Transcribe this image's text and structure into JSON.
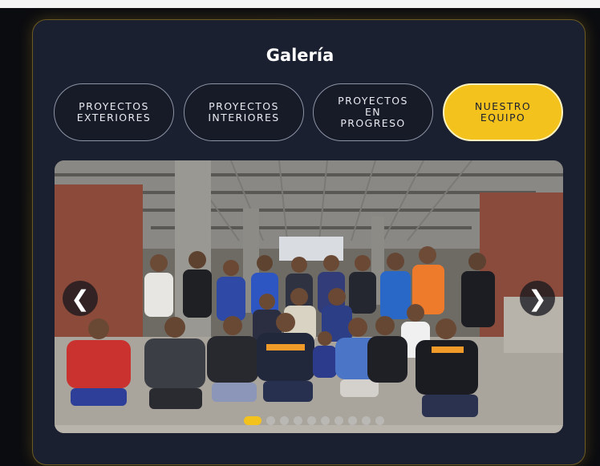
{
  "gallery_section": {
    "title": "Galería",
    "tabs": [
      {
        "label": "PROYECTOS\nEXTERIORES",
        "active": false
      },
      {
        "label": "PROYECTOS\nINTERIORES",
        "active": false
      },
      {
        "label": "PROYECTOS\nEN\nPROGRESO",
        "active": false
      },
      {
        "label": "NUESTRO\nEQUIPO",
        "active": true
      }
    ],
    "carousel": {
      "prev_icon": "chevron-left-icon",
      "next_icon": "chevron-right-icon",
      "prev_glyph": "❮",
      "next_glyph": "❯",
      "slide_count": 10,
      "active_slide": 1
    },
    "colors": {
      "accent": "#f4c21d",
      "card_bg": "#1b2030",
      "page_bg": "#0b0c10"
    }
  }
}
